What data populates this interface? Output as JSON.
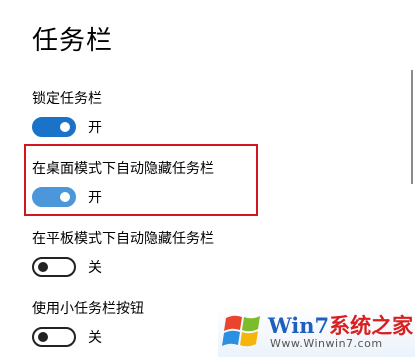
{
  "page": {
    "title": "任务栏"
  },
  "settings": [
    {
      "label": "锁定任务栏",
      "state": "开",
      "on": true
    },
    {
      "label": "在桌面模式下自动隐藏任务栏",
      "state": "开",
      "on": true
    },
    {
      "label": "在平板模式下自动隐藏任务栏",
      "state": "关",
      "on": false
    },
    {
      "label": "使用小任务栏按钮",
      "state": "关",
      "on": false
    }
  ],
  "colors": {
    "accent": "#1a73c8",
    "highlight": "#d0161e"
  },
  "watermark": {
    "brand_part1": "Win7",
    "brand_part2": "系统之家",
    "url": "Www.Winwin7.com"
  }
}
